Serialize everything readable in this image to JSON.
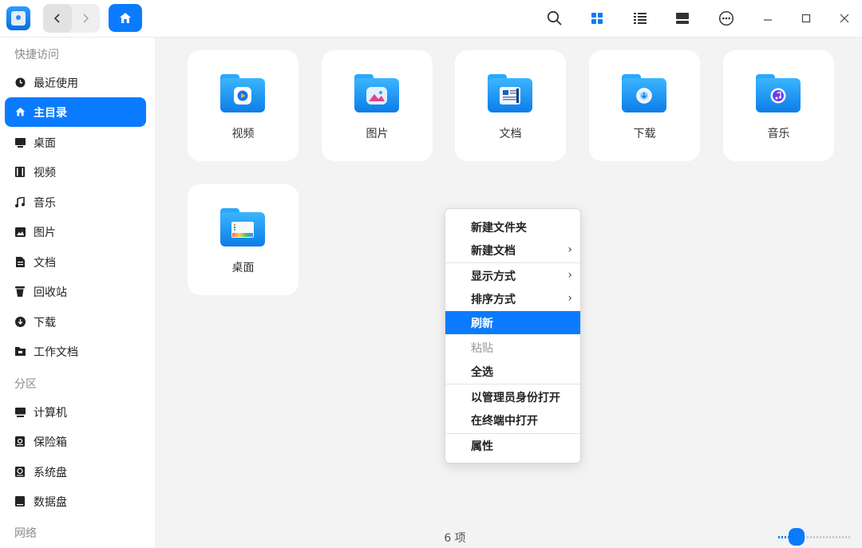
{
  "toolbar": {
    "back_icon": "chevron-left-icon",
    "forward_icon": "chevron-right-icon",
    "home_icon": "home-icon",
    "icons": [
      "search-icon",
      "icon-view-icon",
      "list-view-icon",
      "detail-view-icon",
      "more-icon",
      "minimize-icon",
      "maximize-icon",
      "close-icon"
    ]
  },
  "sidebar": {
    "sections": [
      "快捷访问",
      "分区",
      "网络"
    ],
    "quick": [
      {
        "label": "最近使用",
        "icon": "clock-icon"
      },
      {
        "label": "主目录",
        "icon": "home-icon",
        "active": true
      },
      {
        "label": "桌面",
        "icon": "desktop-icon"
      },
      {
        "label": "视频",
        "icon": "video-icon"
      },
      {
        "label": "音乐",
        "icon": "music-icon"
      },
      {
        "label": "图片",
        "icon": "picture-icon"
      },
      {
        "label": "文档",
        "icon": "document-icon"
      },
      {
        "label": "回收站",
        "icon": "trash-icon"
      },
      {
        "label": "下载",
        "icon": "download-icon"
      },
      {
        "label": "工作文档",
        "icon": "folder-icon"
      }
    ],
    "partitions": [
      {
        "label": "计算机",
        "icon": "computer-icon"
      },
      {
        "label": "保险箱",
        "icon": "vault-icon"
      },
      {
        "label": "系统盘",
        "icon": "system-disk-icon"
      },
      {
        "label": "数据盘",
        "icon": "data-disk-icon"
      }
    ]
  },
  "folders": [
    {
      "label": "视频",
      "icon": "video-folder-icon"
    },
    {
      "label": "图片",
      "icon": "picture-folder-icon"
    },
    {
      "label": "文档",
      "icon": "document-folder-icon"
    },
    {
      "label": "下载",
      "icon": "download-folder-icon"
    },
    {
      "label": "音乐",
      "icon": "music-folder-icon"
    },
    {
      "label": "桌面",
      "icon": "desktop-folder-icon"
    }
  ],
  "context_menu": {
    "items": [
      {
        "label": "新建文件夹"
      },
      {
        "label": "新建文档",
        "submenu": true
      },
      {
        "label": "显示方式",
        "submenu": true
      },
      {
        "label": "排序方式",
        "submenu": true
      },
      {
        "label": "刷新",
        "highlighted": true
      },
      {
        "label": "粘贴",
        "disabled": true
      },
      {
        "label": "全选"
      },
      {
        "label": "以管理员身份打开"
      },
      {
        "label": "在终端中打开"
      },
      {
        "label": "属性"
      }
    ],
    "submenu_glyph": "›"
  },
  "status": {
    "count": "6 项"
  },
  "zoom": {
    "level_fraction": 0.15
  },
  "colors": {
    "accent": "#0a7bff",
    "folder": "#1f95f5"
  }
}
